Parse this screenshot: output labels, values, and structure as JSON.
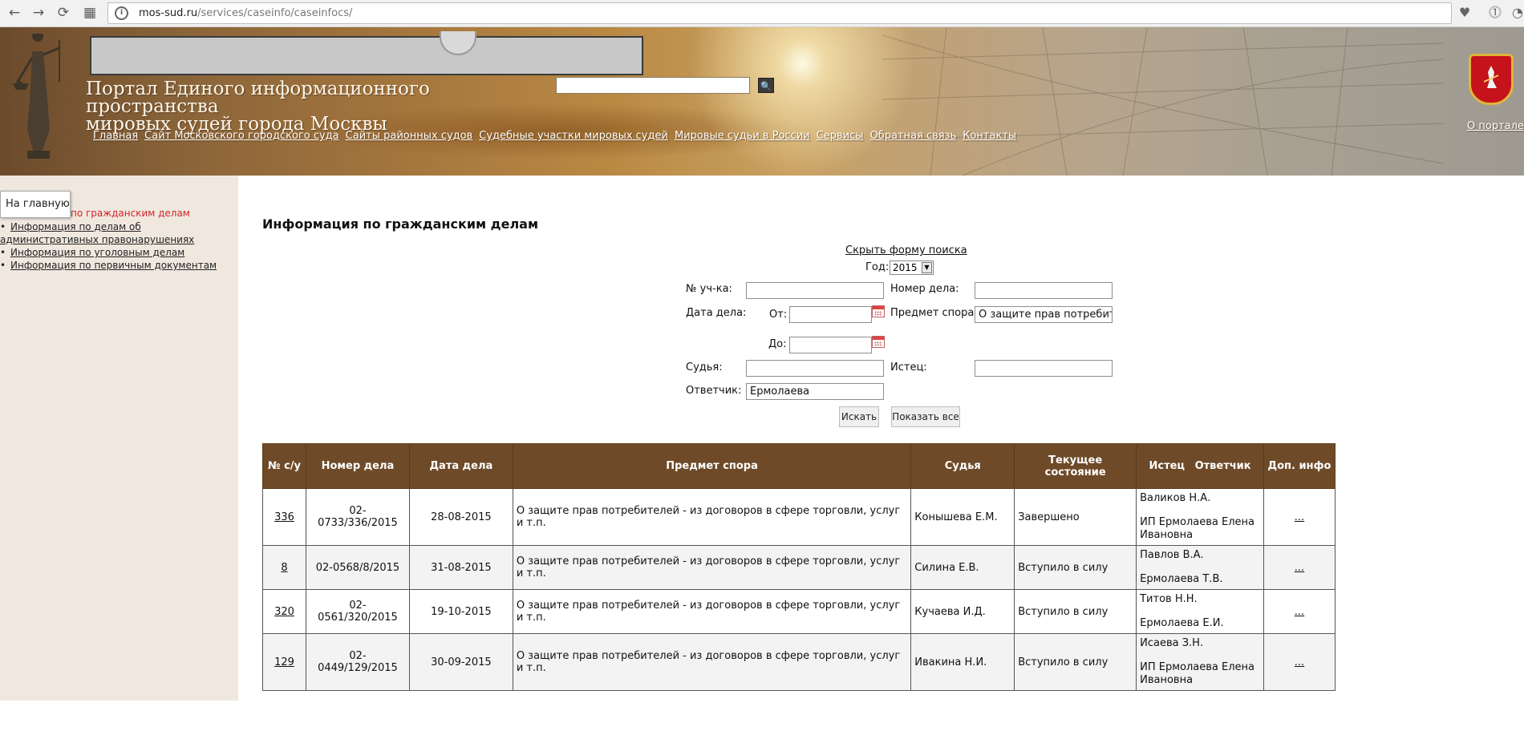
{
  "browser": {
    "url_domain": "mos-sud.ru",
    "url_path": "/services/caseinfo/caseinfocs/",
    "back": "←",
    "forward": "→",
    "reload": "⟳",
    "apps": "▦"
  },
  "header": {
    "title_line1": "Портал Единого информационного пространства",
    "title_line2": "мировых судей города Москвы",
    "search_value": "",
    "search_button": "🔍",
    "nav": [
      "Главная",
      "Сайт Московского городского суда",
      "Сайты районных судов",
      "Судебные участки мировых судей",
      "Мировые судьи в России",
      "Сервисы",
      "Обратная связь",
      "Контакты"
    ],
    "about_link": "О портале"
  },
  "sidebar": {
    "tooltip": "На главную",
    "active_item": "по гражданским делам",
    "items": [
      "Информация по делам об административных правонарушениях",
      "Информация по уголовным делам",
      "Информация по первичным документам"
    ]
  },
  "main": {
    "heading": "Информация по гражданским делам",
    "hide_form_link": "Скрыть форму поиска"
  },
  "form": {
    "year_label": "Год:",
    "year_value": "2015",
    "section_label": "№ уч-ка:",
    "section_value": "",
    "case_number_label": "Номер дела:",
    "case_number_value": "",
    "case_date_label": "Дата дела:",
    "from_label": "От:",
    "from_value": "",
    "to_label": "До:",
    "to_value": "",
    "subject_label": "Предмет спора:",
    "subject_value": "О защите прав потребителей",
    "judge_label": "Судья:",
    "judge_value": "",
    "plaintiff_label": "Истец:",
    "plaintiff_value": "",
    "defendant_label": "Ответчик:",
    "defendant_value": "Ермолаева",
    "search_button": "Искать",
    "show_all_button": "Показать все"
  },
  "table": {
    "headers": {
      "num": "№ с/у",
      "case_number": "Номер дела",
      "case_date": "Дата дела",
      "subject": "Предмет спора",
      "judge": "Судья",
      "state": "Текущее состояние",
      "plaintiff": "Истец",
      "defendant": "Ответчик",
      "extra": "Доп. инфо"
    },
    "rows": [
      {
        "num": "336",
        "case_number": "02-0733/336/2015",
        "case_date": "28-08-2015",
        "subject": "О защите прав потребителей - из договоров в сфере торговли, услуг и т.п.",
        "judge": "Конышева Е.М.",
        "state": "Завершено",
        "plaintiff": "Валиков Н.А.",
        "defendant_line1": "ИП Ермолаева Елена",
        "defendant_line2": "Ивановна",
        "extra": "..."
      },
      {
        "num": "8",
        "case_number": "02-0568/8/2015",
        "case_date": "31-08-2015",
        "subject": "О защите прав потребителей - из договоров в сфере торговли, услуг и т.п.",
        "judge": "Силина Е.В.",
        "state": "Вступило в силу",
        "plaintiff": "Павлов В.А.",
        "defendant_line1": "Ермолаева Т.В.",
        "defendant_line2": "",
        "extra": "..."
      },
      {
        "num": "320",
        "case_number": "02-0561/320/2015",
        "case_date": "19-10-2015",
        "subject": "О защите прав потребителей - из договоров в сфере торговли, услуг и т.п.",
        "judge": "Кучаева И.Д.",
        "state": "Вступило в силу",
        "plaintiff": "Титов Н.Н.",
        "defendant_line1": "Ермолаева Е.И.",
        "defendant_line2": "",
        "extra": "..."
      },
      {
        "num": "129",
        "case_number": "02-0449/129/2015",
        "case_date": "30-09-2015",
        "subject": "О защите прав потребителей - из договоров в сфере торговли, услуг и т.п.",
        "judge": "Ивакина Н.И.",
        "state": "Вступило в силу",
        "plaintiff": "Исаева З.Н.",
        "defendant_line1": "ИП Ермолаева Елена",
        "defendant_line2": "Ивановна",
        "extra": "..."
      }
    ]
  },
  "icons": {
    "info": "info-icon",
    "bookmark": "heart-icon",
    "calendar": "calendar-icon",
    "search": "magnifier-icon",
    "dropdown": "chevron-down-icon"
  },
  "colors": {
    "table_header": "#6e4a28",
    "sidebar_bg": "#f0e8df",
    "active_link": "#d0262a",
    "coat_red": "#c5121b"
  }
}
